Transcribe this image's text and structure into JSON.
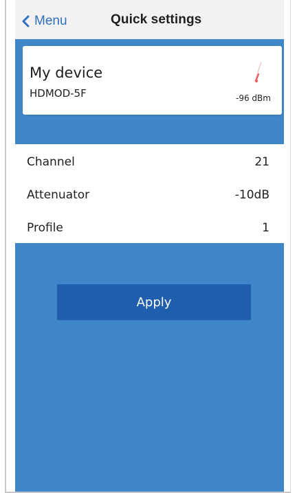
{
  "header": {
    "back_label": "Menu",
    "title": "Quick settings",
    "back_icon": "chevron-left-icon",
    "accent_color": "#2f6fbf"
  },
  "device": {
    "name": "My device",
    "model": "HDMOD-5F",
    "signal_text": "-96 dBm",
    "signal_icon": "signal-meter-icon"
  },
  "settings": {
    "rows": [
      {
        "label": "Channel",
        "value": "21"
      },
      {
        "label": "Attenuator",
        "value": "-10dB"
      },
      {
        "label": "Profile",
        "value": "1"
      }
    ]
  },
  "actions": {
    "apply_label": "Apply"
  },
  "colors": {
    "background_blue": "#3f86c9",
    "apply_button": "#1f5fae",
    "card": "#ffffff",
    "header": "#f2f2f2"
  }
}
